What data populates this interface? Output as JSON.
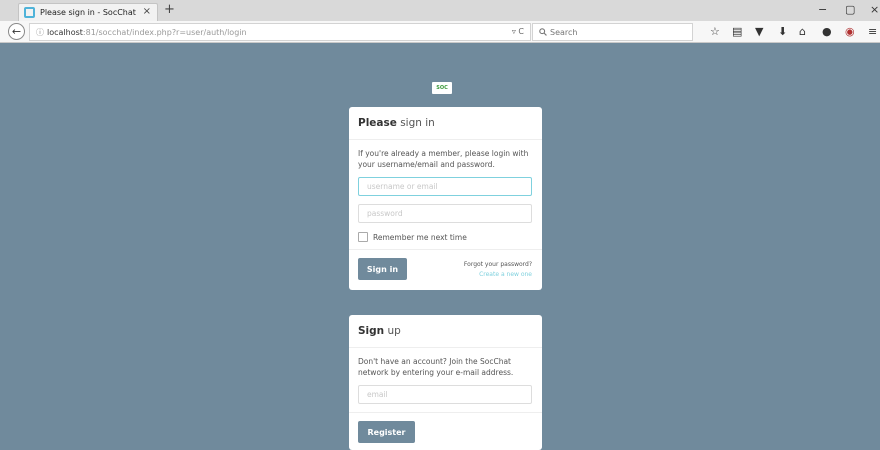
{
  "browser": {
    "tab_title": "Please sign in - SocChat",
    "tab_close": "×",
    "new_tab": "+",
    "url_host": "localhost",
    "url_rest": ":81/socchat/index.php?r=user/auth/login",
    "url_controls": "▿ C",
    "search_placeholder": "Search",
    "window_controls": {
      "minimize": "−",
      "maximize": "▢",
      "close": "×"
    },
    "toolbar_icons": [
      "bookmark-star-icon",
      "reading-list-icon",
      "pocket-icon",
      "download-icon",
      "home-icon",
      "chat-icon",
      "shield-icon",
      "menu-icon"
    ]
  },
  "logo_text": "SOC",
  "signin": {
    "heading_bold": "Please",
    "heading_rest": " sign in",
    "description": "If you're already a member, please login with your username/email and password.",
    "username_placeholder": "username or email",
    "password_placeholder": "password",
    "remember_label": "Remember me next time",
    "button_label": "Sign in",
    "forgot_link": "Forgot your password?",
    "create_link": "Create a new one"
  },
  "signup": {
    "heading_bold": "Sign",
    "heading_rest": " up",
    "description": "Don't have an account? Join the SocChat network by entering your e-mail address.",
    "email_placeholder": "email",
    "button_label": "Register"
  },
  "colors": {
    "background": "#708a9c",
    "button": "#708a9c",
    "focus_border": "#7fd1de",
    "link": "#7fd1de"
  }
}
